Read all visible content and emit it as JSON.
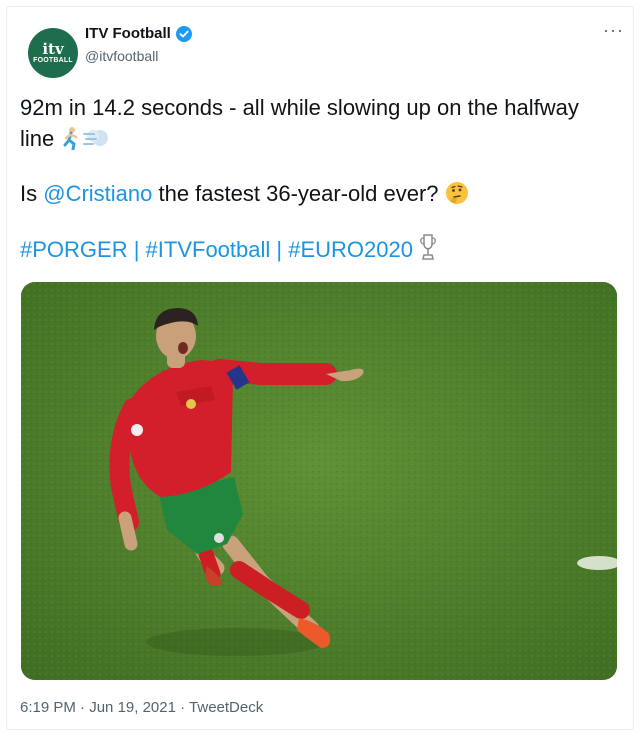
{
  "account": {
    "logo_top": "itv",
    "logo_bottom": "FOOTBALL",
    "display_name": "ITV Football",
    "handle": "@itvfootball"
  },
  "more_label": "···",
  "tweet": {
    "line1": "92m in 14.2 seconds - all while slowing up on the halfway line",
    "line2_prefix": "Is ",
    "line2_mention": "@Cristiano",
    "line2_suffix": " the fastest 36-year-old ever?",
    "hashtag1": "#PORGER",
    "sep": " | ",
    "hashtag2": "#ITVFootball",
    "hashtag3": "#EURO2020"
  },
  "footer": {
    "time": "6:19 PM",
    "dot": " · ",
    "date": "Jun 19, 2021",
    "source": "TweetDeck"
  },
  "colors": {
    "link": "#1b95e0",
    "verified": "#1d9bf0",
    "pitch": "#4f7f2c",
    "avatar": "#1e6e4e"
  },
  "icons": [
    "verified-badge-icon",
    "running-emoji-icon",
    "dash-emoji-icon",
    "thinking-face-emoji-icon",
    "trophy-emoji-icon",
    "more-options-icon"
  ]
}
